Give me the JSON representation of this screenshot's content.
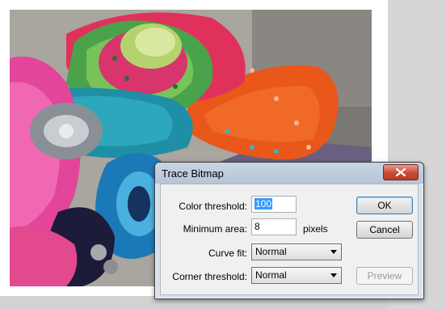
{
  "dialog": {
    "title": "Trace Bitmap",
    "fields": {
      "color_threshold": {
        "label": "Color threshold:",
        "value": "100"
      },
      "minimum_area": {
        "label": "Minimum area:",
        "value": "8",
        "unit": "pixels"
      },
      "curve_fit": {
        "label": "Curve fit:",
        "value": "Normal"
      },
      "corner_threshold": {
        "label": "Corner threshold:",
        "value": "Normal"
      }
    },
    "buttons": {
      "ok": "OK",
      "cancel": "Cancel",
      "preview": "Preview"
    }
  },
  "icons": {
    "close": "close-icon",
    "dropdown": "chevron-down-icon"
  },
  "colors": {
    "close_button": "#c74b37",
    "selection": "#3399ff",
    "default_button_border": "#3c7fb1"
  }
}
